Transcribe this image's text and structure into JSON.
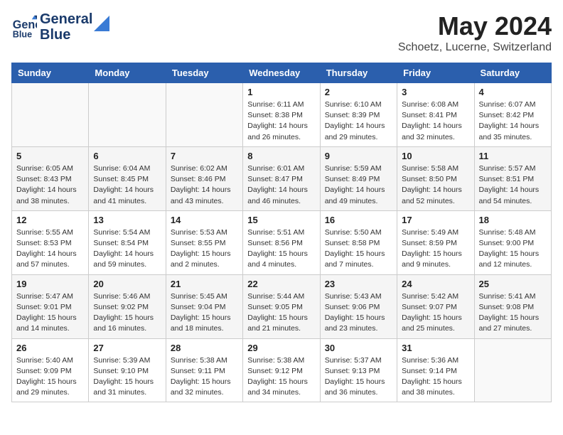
{
  "header": {
    "logo_line1": "General",
    "logo_line2": "Blue",
    "month": "May 2024",
    "location": "Schoetz, Lucerne, Switzerland"
  },
  "weekdays": [
    "Sunday",
    "Monday",
    "Tuesday",
    "Wednesday",
    "Thursday",
    "Friday",
    "Saturday"
  ],
  "weeks": [
    [
      {
        "day": "",
        "info": ""
      },
      {
        "day": "",
        "info": ""
      },
      {
        "day": "",
        "info": ""
      },
      {
        "day": "1",
        "info": "Sunrise: 6:11 AM\nSunset: 8:38 PM\nDaylight: 14 hours\nand 26 minutes."
      },
      {
        "day": "2",
        "info": "Sunrise: 6:10 AM\nSunset: 8:39 PM\nDaylight: 14 hours\nand 29 minutes."
      },
      {
        "day": "3",
        "info": "Sunrise: 6:08 AM\nSunset: 8:41 PM\nDaylight: 14 hours\nand 32 minutes."
      },
      {
        "day": "4",
        "info": "Sunrise: 6:07 AM\nSunset: 8:42 PM\nDaylight: 14 hours\nand 35 minutes."
      }
    ],
    [
      {
        "day": "5",
        "info": "Sunrise: 6:05 AM\nSunset: 8:43 PM\nDaylight: 14 hours\nand 38 minutes."
      },
      {
        "day": "6",
        "info": "Sunrise: 6:04 AM\nSunset: 8:45 PM\nDaylight: 14 hours\nand 41 minutes."
      },
      {
        "day": "7",
        "info": "Sunrise: 6:02 AM\nSunset: 8:46 PM\nDaylight: 14 hours\nand 43 minutes."
      },
      {
        "day": "8",
        "info": "Sunrise: 6:01 AM\nSunset: 8:47 PM\nDaylight: 14 hours\nand 46 minutes."
      },
      {
        "day": "9",
        "info": "Sunrise: 5:59 AM\nSunset: 8:49 PM\nDaylight: 14 hours\nand 49 minutes."
      },
      {
        "day": "10",
        "info": "Sunrise: 5:58 AM\nSunset: 8:50 PM\nDaylight: 14 hours\nand 52 minutes."
      },
      {
        "day": "11",
        "info": "Sunrise: 5:57 AM\nSunset: 8:51 PM\nDaylight: 14 hours\nand 54 minutes."
      }
    ],
    [
      {
        "day": "12",
        "info": "Sunrise: 5:55 AM\nSunset: 8:53 PM\nDaylight: 14 hours\nand 57 minutes."
      },
      {
        "day": "13",
        "info": "Sunrise: 5:54 AM\nSunset: 8:54 PM\nDaylight: 14 hours\nand 59 minutes."
      },
      {
        "day": "14",
        "info": "Sunrise: 5:53 AM\nSunset: 8:55 PM\nDaylight: 15 hours\nand 2 minutes."
      },
      {
        "day": "15",
        "info": "Sunrise: 5:51 AM\nSunset: 8:56 PM\nDaylight: 15 hours\nand 4 minutes."
      },
      {
        "day": "16",
        "info": "Sunrise: 5:50 AM\nSunset: 8:58 PM\nDaylight: 15 hours\nand 7 minutes."
      },
      {
        "day": "17",
        "info": "Sunrise: 5:49 AM\nSunset: 8:59 PM\nDaylight: 15 hours\nand 9 minutes."
      },
      {
        "day": "18",
        "info": "Sunrise: 5:48 AM\nSunset: 9:00 PM\nDaylight: 15 hours\nand 12 minutes."
      }
    ],
    [
      {
        "day": "19",
        "info": "Sunrise: 5:47 AM\nSunset: 9:01 PM\nDaylight: 15 hours\nand 14 minutes."
      },
      {
        "day": "20",
        "info": "Sunrise: 5:46 AM\nSunset: 9:02 PM\nDaylight: 15 hours\nand 16 minutes."
      },
      {
        "day": "21",
        "info": "Sunrise: 5:45 AM\nSunset: 9:04 PM\nDaylight: 15 hours\nand 18 minutes."
      },
      {
        "day": "22",
        "info": "Sunrise: 5:44 AM\nSunset: 9:05 PM\nDaylight: 15 hours\nand 21 minutes."
      },
      {
        "day": "23",
        "info": "Sunrise: 5:43 AM\nSunset: 9:06 PM\nDaylight: 15 hours\nand 23 minutes."
      },
      {
        "day": "24",
        "info": "Sunrise: 5:42 AM\nSunset: 9:07 PM\nDaylight: 15 hours\nand 25 minutes."
      },
      {
        "day": "25",
        "info": "Sunrise: 5:41 AM\nSunset: 9:08 PM\nDaylight: 15 hours\nand 27 minutes."
      }
    ],
    [
      {
        "day": "26",
        "info": "Sunrise: 5:40 AM\nSunset: 9:09 PM\nDaylight: 15 hours\nand 29 minutes."
      },
      {
        "day": "27",
        "info": "Sunrise: 5:39 AM\nSunset: 9:10 PM\nDaylight: 15 hours\nand 31 minutes."
      },
      {
        "day": "28",
        "info": "Sunrise: 5:38 AM\nSunset: 9:11 PM\nDaylight: 15 hours\nand 32 minutes."
      },
      {
        "day": "29",
        "info": "Sunrise: 5:38 AM\nSunset: 9:12 PM\nDaylight: 15 hours\nand 34 minutes."
      },
      {
        "day": "30",
        "info": "Sunrise: 5:37 AM\nSunset: 9:13 PM\nDaylight: 15 hours\nand 36 minutes."
      },
      {
        "day": "31",
        "info": "Sunrise: 5:36 AM\nSunset: 9:14 PM\nDaylight: 15 hours\nand 38 minutes."
      },
      {
        "day": "",
        "info": ""
      }
    ]
  ]
}
